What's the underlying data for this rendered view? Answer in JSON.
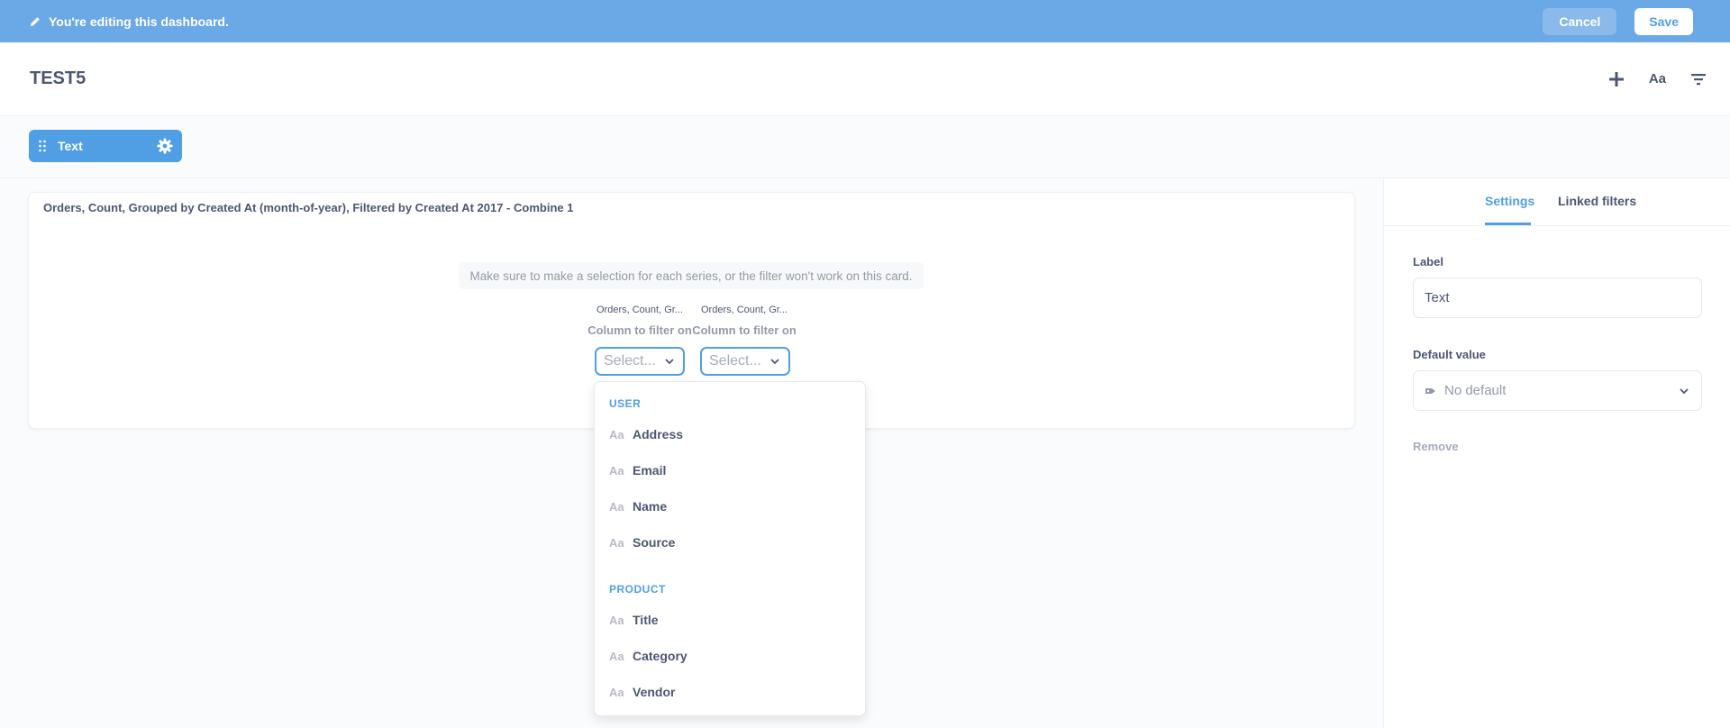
{
  "edit_bar": {
    "icon": "pencil-icon",
    "message": "You're editing this dashboard.",
    "cancel_label": "Cancel",
    "save_label": "Save"
  },
  "header": {
    "title": "TEST5",
    "tools": [
      "plus-icon",
      "text-aa-icon",
      "filter-icon"
    ],
    "text_tool_label": "Aa"
  },
  "filter_widget": {
    "label": "Text",
    "icons": [
      "grip-icon",
      "gear-icon"
    ]
  },
  "card": {
    "title": "Orders, Count, Grouped by Created At (month-of-year), Filtered by Created At 2017 - Combine 1",
    "warning": "Make sure to make a selection for each series, or the filter won't work on this card.",
    "mappings": [
      {
        "series_name": "Orders, Count, Gr...",
        "column_label": "Column to filter on",
        "select_placeholder": "Select..."
      },
      {
        "series_name": "Orders, Count, Gr...",
        "column_label": "Column to filter on",
        "select_placeholder": "Select..."
      }
    ]
  },
  "dropdown": {
    "sections": [
      {
        "name": "USER",
        "options": [
          "Address",
          "Email",
          "Name",
          "Source"
        ]
      },
      {
        "name": "PRODUCT",
        "options": [
          "Title",
          "Category",
          "Vendor"
        ]
      }
    ],
    "option_icon_label": "Aa"
  },
  "sidebar": {
    "tabs": [
      {
        "label": "Settings",
        "active": true
      },
      {
        "label": "Linked filters",
        "active": false
      }
    ],
    "label_field": {
      "label": "Label",
      "value": "Text"
    },
    "default_value": {
      "label": "Default value",
      "value": "No default",
      "icon": "tag-icon"
    },
    "remove_label": "Remove"
  },
  "colors": {
    "edit_bar": "#6aa8e6",
    "brand": "#509ee3",
    "text_dark": "#4c5773",
    "text_muted": "#949aab"
  }
}
